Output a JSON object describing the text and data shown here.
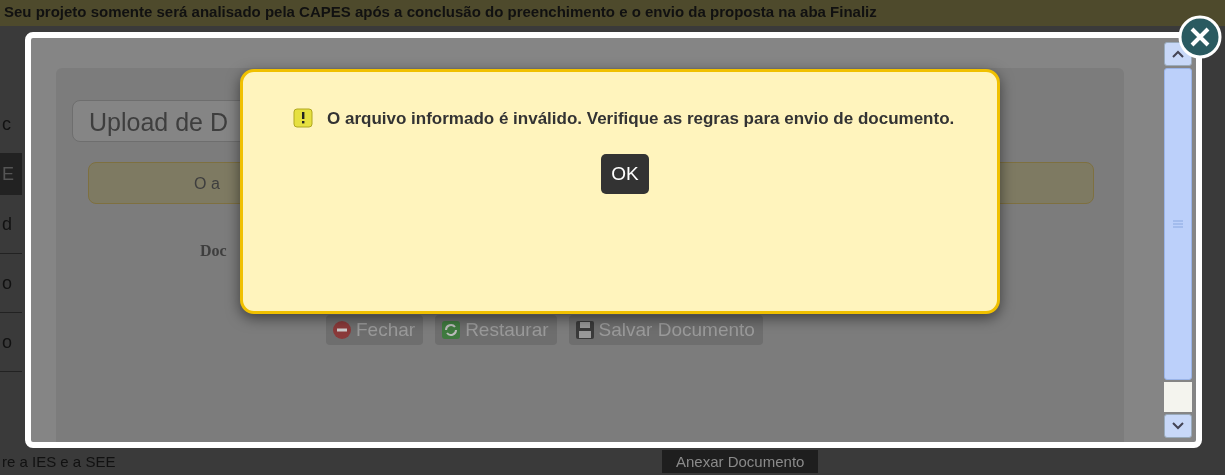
{
  "page": {
    "notice": "Seu projeto somente será analisado pela CAPES após a conclusão do preenchimento e o envio da proposta na aba Finaliz",
    "side_fragments": [
      "c",
      "E",
      "d",
      "o",
      "o"
    ],
    "footer_text": "re a IES e a SEE",
    "footer_button": "Anexar Documento"
  },
  "upload_window": {
    "title": "Upload de D",
    "message": "O a",
    "field_label": "Doc",
    "buttons": [
      {
        "label": "Fechar",
        "kind": "close"
      },
      {
        "label": "Restaurar",
        "kind": "restore"
      },
      {
        "label": "Salvar Documento",
        "kind": "save"
      }
    ]
  },
  "alert": {
    "message": "O arquivo informado é inválido. Verifique as regras para envio de documento.",
    "button": "OK"
  }
}
